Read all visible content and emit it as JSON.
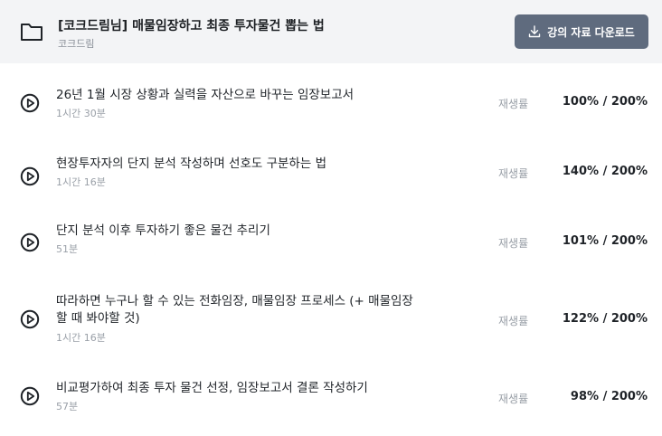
{
  "course": {
    "title": "[코크드림님] 매물임장하고 최종 투자물건 뽑는 법",
    "author": "코크드림",
    "download_label": "강의 자료 다운로드"
  },
  "rate_label": "재생률",
  "lessons": [
    {
      "title": "26년 1월 시장 상황과 실력을 자산으로 바꾸는 임장보고서",
      "duration": "1시간 30분",
      "rate": "100% / 200%"
    },
    {
      "title": "현장투자자의 단지 분석 작성하며 선호도 구분하는 법",
      "duration": "1시간 16분",
      "rate": "140% / 200%"
    },
    {
      "title": "단지 분석 이후 투자하기 좋은 물건 추리기",
      "duration": "51분",
      "rate": "101% / 200%"
    },
    {
      "title_line1": "따라하면 누구나 할 수 있는 전화임장, 매물임장 프로세스 (+ 매물임장",
      "title_line2": "할 때 봐야할 것)",
      "duration": "1시간 16분",
      "rate": "122% / 200%"
    },
    {
      "title": "비교평가하여 최종 투자 물건 선정, 임장보고서 결론 작성하기",
      "duration": "57분",
      "rate": "98% / 200%"
    }
  ]
}
